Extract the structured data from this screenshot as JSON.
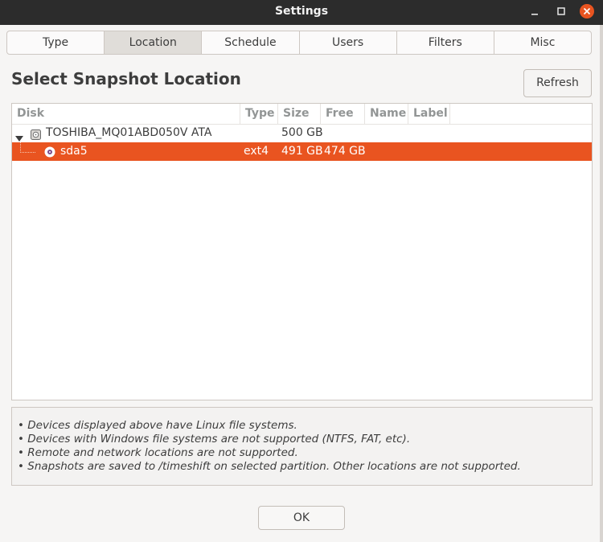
{
  "window": {
    "title": "Settings"
  },
  "tabs": [
    {
      "label": "Type"
    },
    {
      "label": "Location",
      "active": true
    },
    {
      "label": "Schedule"
    },
    {
      "label": "Users"
    },
    {
      "label": "Filters"
    },
    {
      "label": "Misc"
    }
  ],
  "page": {
    "heading": "Select Snapshot Location",
    "refresh_label": "Refresh"
  },
  "table": {
    "columns": [
      "Disk",
      "Type",
      "Size",
      "Free",
      "Name",
      "Label"
    ],
    "rows": [
      {
        "disk": "TOSHIBA_MQ01ABD050V ATA",
        "type": "",
        "size": "500 GB",
        "free": "",
        "name": "",
        "label": "",
        "expanded": true,
        "icon": "hard-disk-icon"
      },
      {
        "disk": "sda5",
        "type": "ext4",
        "size": "491 GB",
        "free": "474 GB",
        "name": "",
        "label": "",
        "selected": true,
        "icon": "partition-icon"
      }
    ]
  },
  "notes": [
    "• Devices displayed above have Linux file systems.",
    "• Devices with Windows file systems are not supported (NTFS, FAT, etc).",
    "• Remote and network locations are not supported.",
    "• Snapshots are saved to /timeshift on selected partition. Other locations are not supported."
  ],
  "footer": {
    "ok_label": "OK"
  },
  "colors": {
    "accent": "#e95420",
    "titlebar": "#2c2c2c",
    "close_button": "#e95420"
  }
}
